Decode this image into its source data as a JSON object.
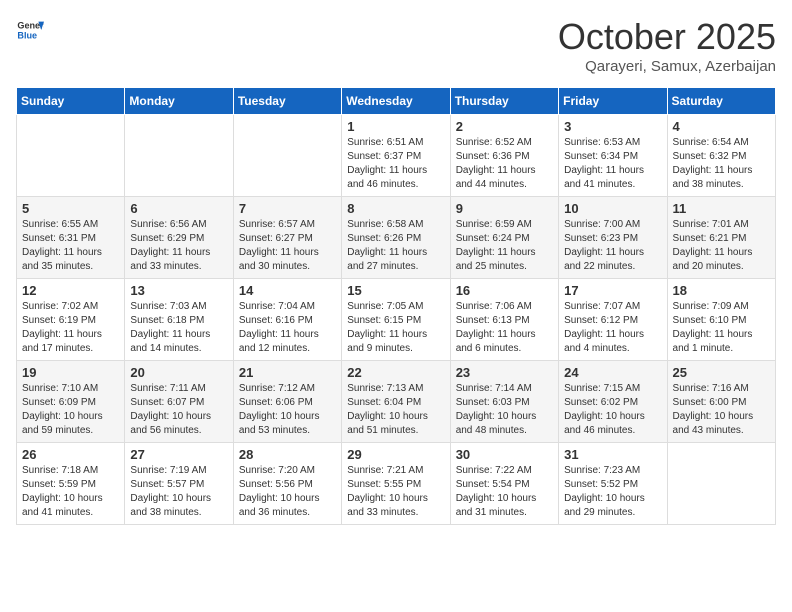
{
  "header": {
    "logo_general": "General",
    "logo_blue": "Blue",
    "month_title": "October 2025",
    "location": "Qarayeri, Samux, Azerbaijan"
  },
  "days_of_week": [
    "Sunday",
    "Monday",
    "Tuesday",
    "Wednesday",
    "Thursday",
    "Friday",
    "Saturday"
  ],
  "weeks": [
    [
      {
        "day": "",
        "info": ""
      },
      {
        "day": "",
        "info": ""
      },
      {
        "day": "",
        "info": ""
      },
      {
        "day": "1",
        "info": "Sunrise: 6:51 AM\nSunset: 6:37 PM\nDaylight: 11 hours\nand 46 minutes."
      },
      {
        "day": "2",
        "info": "Sunrise: 6:52 AM\nSunset: 6:36 PM\nDaylight: 11 hours\nand 44 minutes."
      },
      {
        "day": "3",
        "info": "Sunrise: 6:53 AM\nSunset: 6:34 PM\nDaylight: 11 hours\nand 41 minutes."
      },
      {
        "day": "4",
        "info": "Sunrise: 6:54 AM\nSunset: 6:32 PM\nDaylight: 11 hours\nand 38 minutes."
      }
    ],
    [
      {
        "day": "5",
        "info": "Sunrise: 6:55 AM\nSunset: 6:31 PM\nDaylight: 11 hours\nand 35 minutes."
      },
      {
        "day": "6",
        "info": "Sunrise: 6:56 AM\nSunset: 6:29 PM\nDaylight: 11 hours\nand 33 minutes."
      },
      {
        "day": "7",
        "info": "Sunrise: 6:57 AM\nSunset: 6:27 PM\nDaylight: 11 hours\nand 30 minutes."
      },
      {
        "day": "8",
        "info": "Sunrise: 6:58 AM\nSunset: 6:26 PM\nDaylight: 11 hours\nand 27 minutes."
      },
      {
        "day": "9",
        "info": "Sunrise: 6:59 AM\nSunset: 6:24 PM\nDaylight: 11 hours\nand 25 minutes."
      },
      {
        "day": "10",
        "info": "Sunrise: 7:00 AM\nSunset: 6:23 PM\nDaylight: 11 hours\nand 22 minutes."
      },
      {
        "day": "11",
        "info": "Sunrise: 7:01 AM\nSunset: 6:21 PM\nDaylight: 11 hours\nand 20 minutes."
      }
    ],
    [
      {
        "day": "12",
        "info": "Sunrise: 7:02 AM\nSunset: 6:19 PM\nDaylight: 11 hours\nand 17 minutes."
      },
      {
        "day": "13",
        "info": "Sunrise: 7:03 AM\nSunset: 6:18 PM\nDaylight: 11 hours\nand 14 minutes."
      },
      {
        "day": "14",
        "info": "Sunrise: 7:04 AM\nSunset: 6:16 PM\nDaylight: 11 hours\nand 12 minutes."
      },
      {
        "day": "15",
        "info": "Sunrise: 7:05 AM\nSunset: 6:15 PM\nDaylight: 11 hours\nand 9 minutes."
      },
      {
        "day": "16",
        "info": "Sunrise: 7:06 AM\nSunset: 6:13 PM\nDaylight: 11 hours\nand 6 minutes."
      },
      {
        "day": "17",
        "info": "Sunrise: 7:07 AM\nSunset: 6:12 PM\nDaylight: 11 hours\nand 4 minutes."
      },
      {
        "day": "18",
        "info": "Sunrise: 7:09 AM\nSunset: 6:10 PM\nDaylight: 11 hours\nand 1 minute."
      }
    ],
    [
      {
        "day": "19",
        "info": "Sunrise: 7:10 AM\nSunset: 6:09 PM\nDaylight: 10 hours\nand 59 minutes."
      },
      {
        "day": "20",
        "info": "Sunrise: 7:11 AM\nSunset: 6:07 PM\nDaylight: 10 hours\nand 56 minutes."
      },
      {
        "day": "21",
        "info": "Sunrise: 7:12 AM\nSunset: 6:06 PM\nDaylight: 10 hours\nand 53 minutes."
      },
      {
        "day": "22",
        "info": "Sunrise: 7:13 AM\nSunset: 6:04 PM\nDaylight: 10 hours\nand 51 minutes."
      },
      {
        "day": "23",
        "info": "Sunrise: 7:14 AM\nSunset: 6:03 PM\nDaylight: 10 hours\nand 48 minutes."
      },
      {
        "day": "24",
        "info": "Sunrise: 7:15 AM\nSunset: 6:02 PM\nDaylight: 10 hours\nand 46 minutes."
      },
      {
        "day": "25",
        "info": "Sunrise: 7:16 AM\nSunset: 6:00 PM\nDaylight: 10 hours\nand 43 minutes."
      }
    ],
    [
      {
        "day": "26",
        "info": "Sunrise: 7:18 AM\nSunset: 5:59 PM\nDaylight: 10 hours\nand 41 minutes."
      },
      {
        "day": "27",
        "info": "Sunrise: 7:19 AM\nSunset: 5:57 PM\nDaylight: 10 hours\nand 38 minutes."
      },
      {
        "day": "28",
        "info": "Sunrise: 7:20 AM\nSunset: 5:56 PM\nDaylight: 10 hours\nand 36 minutes."
      },
      {
        "day": "29",
        "info": "Sunrise: 7:21 AM\nSunset: 5:55 PM\nDaylight: 10 hours\nand 33 minutes."
      },
      {
        "day": "30",
        "info": "Sunrise: 7:22 AM\nSunset: 5:54 PM\nDaylight: 10 hours\nand 31 minutes."
      },
      {
        "day": "31",
        "info": "Sunrise: 7:23 AM\nSunset: 5:52 PM\nDaylight: 10 hours\nand 29 minutes."
      },
      {
        "day": "",
        "info": ""
      }
    ]
  ]
}
